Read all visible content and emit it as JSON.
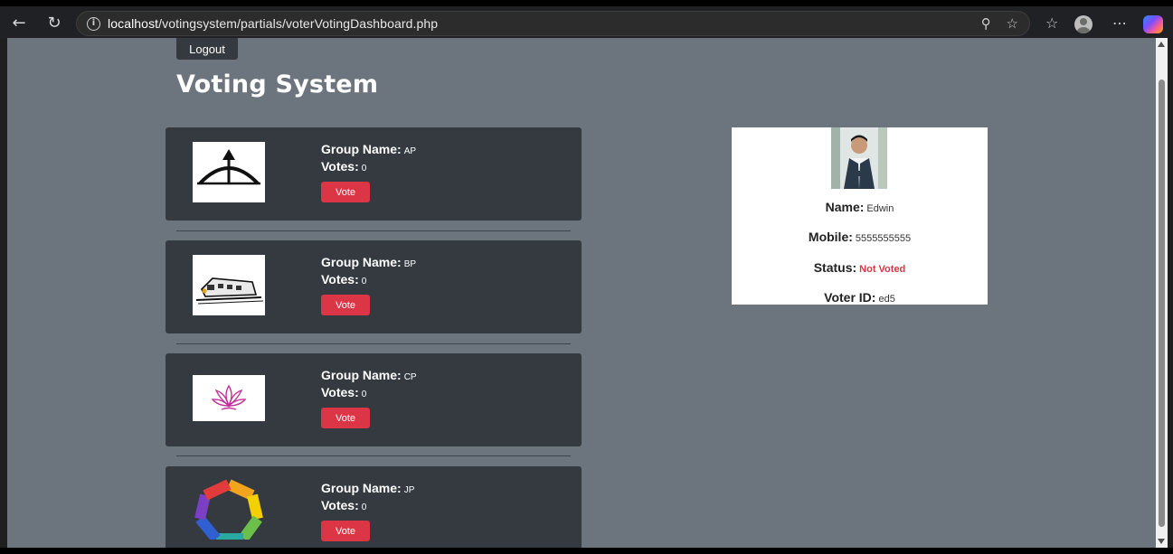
{
  "browser": {
    "url_host": "localhost",
    "url_path": "/votingsystem/partials/voterVotingDashboard.php"
  },
  "header": {
    "logout_label": "Logout",
    "title": "Voting System"
  },
  "groups": [
    {
      "name_label": "Group Name:",
      "name": "AP",
      "votes_label": "Votes:",
      "votes": "0",
      "vote_label": "Vote",
      "logo": "bow-arrow-icon"
    },
    {
      "name_label": "Group Name:",
      "name": "BP",
      "votes_label": "Votes:",
      "votes": "0",
      "vote_label": "Vote",
      "logo": "train-icon"
    },
    {
      "name_label": "Group Name:",
      "name": "CP",
      "votes_label": "Votes:",
      "votes": "0",
      "vote_label": "Vote",
      "logo": "lotus-icon"
    },
    {
      "name_label": "Group Name:",
      "name": "JP",
      "votes_label": "Votes:",
      "votes": "0",
      "vote_label": "Vote",
      "logo": "rainbow-ring-icon"
    }
  ],
  "voter": {
    "name_label": "Name:",
    "name": "Edwin",
    "mobile_label": "Mobile:",
    "mobile": "5555555555",
    "status_label": "Status:",
    "status": "Not Voted",
    "id_label": "Voter ID:",
    "id": "ed5"
  },
  "colors": {
    "page_bg": "#6c757d",
    "card_bg": "#343a40",
    "vote_button": "#dc3545",
    "status_not_voted": "#dc3545"
  }
}
